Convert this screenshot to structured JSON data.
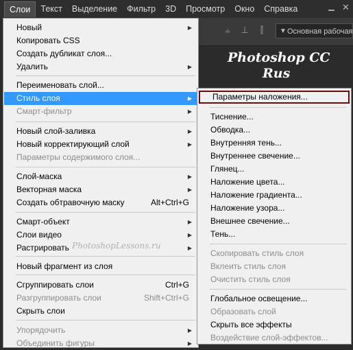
{
  "menubar": {
    "items": [
      "Слои",
      "Текст",
      "Выделение",
      "Фильтр",
      "3D",
      "Просмотр",
      "Окно",
      "Справка"
    ],
    "active": "Слои"
  },
  "options_bar": {
    "workspace_label": "Основная рабочая среда"
  },
  "watermark": {
    "line1": "Photoshop  CC",
    "line2": "Rus",
    "menu_watermark": "PhotoshopLessons.ru"
  },
  "layer_menu": {
    "items": [
      {
        "label": "Новый",
        "arrow": true,
        "disabled": false
      },
      {
        "label": "Копировать CSS",
        "arrow": false,
        "disabled": false
      },
      {
        "label": "Создать дубликат слоя...",
        "arrow": false,
        "disabled": false
      },
      {
        "label": "Удалить",
        "arrow": true,
        "disabled": false
      },
      {
        "label": "Переименовать слой...",
        "arrow": false,
        "disabled": false
      },
      {
        "label": "Стиль слоя",
        "arrow": true,
        "disabled": false,
        "highlight": true
      },
      {
        "label": "Смарт-фильтр",
        "arrow": true,
        "disabled": true
      },
      {
        "label": "Новый слой-заливка",
        "arrow": true,
        "disabled": false
      },
      {
        "label": "Новый корректирующий слой",
        "arrow": true,
        "disabled": false
      },
      {
        "label": "Параметры содержимого слоя...",
        "arrow": false,
        "disabled": true
      },
      {
        "label": "Слой-маска",
        "arrow": true,
        "disabled": false
      },
      {
        "label": "Векторная маска",
        "arrow": true,
        "disabled": false
      },
      {
        "label": "Создать обтравочную маску",
        "shortcut": "Alt+Ctrl+G",
        "disabled": false
      },
      {
        "label": "Смарт-объект",
        "arrow": true,
        "disabled": false
      },
      {
        "label": "Слои видео",
        "arrow": true,
        "disabled": false
      },
      {
        "label": "Растрировать",
        "arrow": true,
        "disabled": false
      },
      {
        "label": "Новый фрагмент из слоя",
        "arrow": false,
        "disabled": false
      },
      {
        "label": "Сгруппировать слои",
        "shortcut": "Ctrl+G",
        "disabled": false
      },
      {
        "label": "Разгруппировать слои",
        "shortcut": "Shift+Ctrl+G",
        "disabled": true
      },
      {
        "label": "Скрыть слои",
        "arrow": false,
        "disabled": false
      },
      {
        "label": "Упорядочить",
        "arrow": true,
        "disabled": true
      },
      {
        "label": "Объединить фигуры",
        "arrow": true,
        "disabled": true
      }
    ]
  },
  "layer_style_submenu": {
    "items": [
      {
        "label": "Параметры наложения...",
        "disabled": false,
        "boxed": true
      },
      {
        "label": "Тиснение...",
        "disabled": false
      },
      {
        "label": "Обводка...",
        "disabled": false
      },
      {
        "label": "Внутренняя тень...",
        "disabled": false
      },
      {
        "label": "Внутреннее свечение...",
        "disabled": false
      },
      {
        "label": "Глянец...",
        "disabled": false
      },
      {
        "label": "Наложение цвета...",
        "disabled": false
      },
      {
        "label": "Наложение градиента...",
        "disabled": false
      },
      {
        "label": "Наложение узора...",
        "disabled": false
      },
      {
        "label": "Внешнее свечение...",
        "disabled": false
      },
      {
        "label": "Тень...",
        "disabled": false
      },
      {
        "label": "Скопировать стиль слоя",
        "disabled": true
      },
      {
        "label": "Вклеить стиль слоя",
        "disabled": true
      },
      {
        "label": "Очистить стиль слоя",
        "disabled": true
      },
      {
        "label": "Глобальное освещение...",
        "disabled": false
      },
      {
        "label": "Образовать слой",
        "disabled": true
      },
      {
        "label": "Скрыть все эффекты",
        "disabled": false
      },
      {
        "label": "Воздействие слой-эффектов...",
        "disabled": true
      }
    ]
  },
  "colors": {
    "highlight": "#3399ff",
    "boxed_border": "#6b0c0c",
    "disabled_text": "#8c8c8c"
  }
}
